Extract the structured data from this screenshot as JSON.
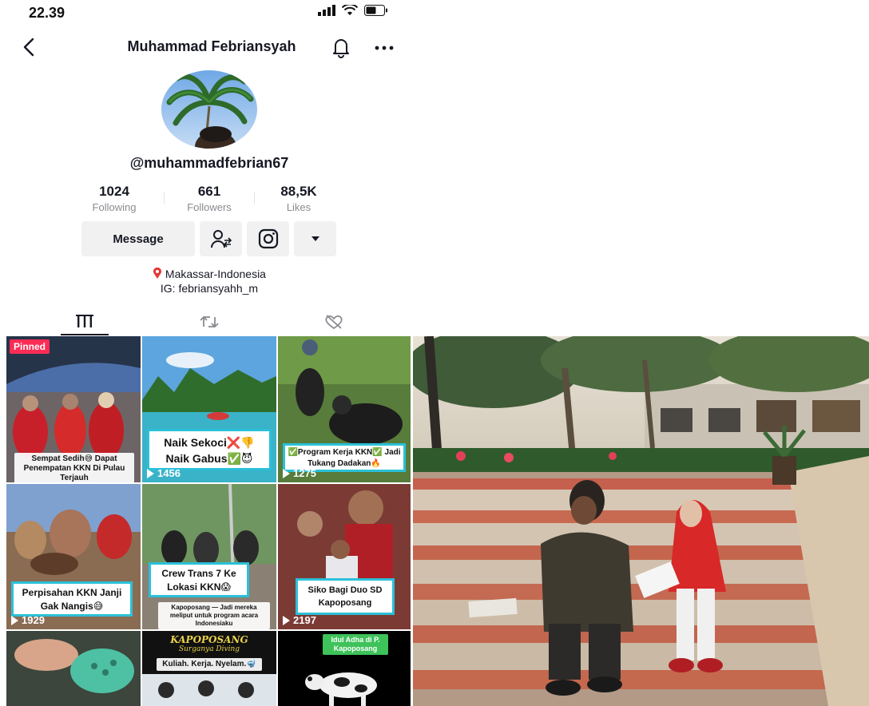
{
  "status_bar": {
    "time": "22.39",
    "battery_icon": "battery-icon",
    "wifi_icon": "wifi-icon",
    "signal_icon": "signal-icon"
  },
  "header": {
    "title": "Muhammad Febriansyah",
    "back_icon": "chevron-left-icon",
    "bell_icon": "bell-icon",
    "more_icon": "more-icon"
  },
  "profile": {
    "username": "@muhammadfebrian67",
    "stats": [
      {
        "value": "1024",
        "label": "Following"
      },
      {
        "value": "661",
        "label": "Followers"
      },
      {
        "value": "88,5K",
        "label": "Likes"
      }
    ],
    "message_label": "Message",
    "bio_location": "Makassar-Indonesia",
    "bio_ig": "IG: febriansyahh_m"
  },
  "tabs": [
    "videos-grid-icon",
    "repost-icon",
    "liked-hidden-icon"
  ],
  "videos": [
    {
      "pinned": "Pinned",
      "caption": "Sempat Sedih😅 Dapat Penempatan KKN Di Pulau Terjauh",
      "views": ""
    },
    {
      "caption": "Naik Sekoci❌👎 Naik Gabus✅😈",
      "views": "1456"
    },
    {
      "caption": "✅Program Kerja KKN✅ Jadi Tukang Dadakan🔥",
      "views": "1275"
    },
    {
      "caption": "Perpisahan KKN Janji Gak Nangis😅",
      "views": "1929"
    },
    {
      "caption": "Crew Trans 7 Ke Lokasi KKN😱",
      "subcaption": "Kapoposang — Jadi mereka meliput untuk program acara Indonesiaku",
      "views": ""
    },
    {
      "caption": "Siko Bagi Duo SD Kapoposang",
      "views": "2197"
    },
    {
      "caption": "",
      "views": ""
    },
    {
      "title": "KAPOPOSANG",
      "subtitle": "Surganya Diving",
      "caption": "Kuliah. Kerja. Nyelam.🤿",
      "views": ""
    },
    {
      "caption": "Idul Adha di P. Kapoposang",
      "views": ""
    }
  ],
  "colors": {
    "pinned": "#fe2c55",
    "caption_border": "#2bc0d8",
    "button_bg": "#f1f1f2",
    "text": "#161823",
    "muted": "#8a8b91"
  }
}
